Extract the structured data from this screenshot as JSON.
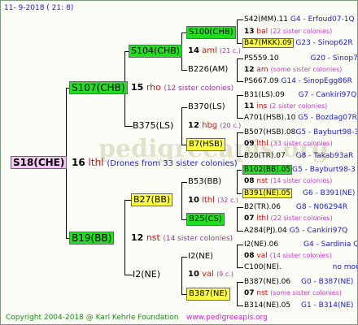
{
  "header": {
    "date": "11- 9-2018 ( 21: 8)"
  },
  "root": {
    "label": "S18(CHE)"
  },
  "root_info": {
    "num": "16",
    "code": "lthl",
    "note": "(Drones from 33 sister colonies)"
  },
  "gen1": [
    {
      "label": "S107(CHB)",
      "num": "15",
      "code": "rho",
      "note": "(12 sister colonies)"
    },
    {
      "label": "B19(BB)",
      "num": "12",
      "code": "nst",
      "note": "(14 sister colonies)"
    }
  ],
  "gen2": [
    {
      "label": "S104(CHB)",
      "num": "14",
      "code": "aml",
      "note": "(21 c.)"
    },
    {
      "label": "B375(LS)",
      "num": "12",
      "code": "hbg",
      "note": "(20 c.)"
    },
    {
      "label": "B27(BB)",
      "num": "10",
      "code": "lthl",
      "note": "(32 c.)"
    },
    {
      "label": "I2(NE)",
      "num": "10",
      "code": "val",
      "note": "(9 c.)"
    }
  ],
  "gen3": [
    {
      "label": "S100(CHB)"
    },
    {
      "label": "B226(AM)"
    },
    {
      "label": "B370(LS)"
    },
    {
      "label": "B7(HSB)"
    },
    {
      "label": "B53(BB)"
    },
    {
      "label": "B25(CS)"
    },
    {
      "label": "I2(NE)"
    },
    {
      "label": "B387(NE)"
    }
  ],
  "gen4": [
    {
      "a": "S42(MM).11",
      "a_note": "G4 - Erfoud07-1Q",
      "m_num": "13",
      "m_code": "bal",
      "m_note": "(22 sister colonies)",
      "b": "B47(MKK).09",
      "b_note": "G23 - Sinop62R"
    },
    {
      "a": "PS559.10",
      "a_note": "G20 - Sinop72R",
      "m_num": "12",
      "m_code": "am",
      "m_note": "(some sister colonies)",
      "b": "PS667.09",
      "b_note": "G14 - SinopEgg86R"
    },
    {
      "a": "B31(LS).09",
      "a_note": "G7 - Cankiri97Q",
      "m_num": "11",
      "m_code": "ins",
      "m_note": "(2 sister colonies)",
      "b": "A701(HSB).10",
      "b_note": "G5 - Bozdag07R"
    },
    {
      "a": "B507(HSB).08",
      "a_note": "G5 - Bayburt98-3",
      "m_num": "09",
      "m_code": "lthl",
      "m_note": "(33 sister colonies)",
      "b": "B20(TR).07",
      "b_note": "G8 - Takab93aR"
    },
    {
      "a": "B102(BB).05",
      "a_note": "G5 - Bayburt98-3",
      "m_num": "08",
      "m_code": "nst",
      "m_note": "(14 sister colonies)",
      "b": "B391(NE).05",
      "b_note": "G6 - B391(NE)"
    },
    {
      "a": "B2(TR).06",
      "a_note": "G8 - N06294R",
      "m_num": "07",
      "m_code": "lthl",
      "m_note": "(22 sister colonies)",
      "b": "A284(PJ).04",
      "b_note": "G5 - Cankiri97Q"
    },
    {
      "a": "I2(NE).06",
      "a_note": "G4 - Sardinia Q",
      "m_num": "08",
      "m_code": "val",
      "m_note": "(14 sister colonies)",
      "b": "C100(NE).",
      "b_note": "no more"
    },
    {
      "a": "B387(NE).06",
      "a_note": "G0 - B387(NE)",
      "m_num": "07",
      "m_code": "nst",
      "m_note": "(some sister colonies)",
      "b": "B314(NE).05",
      "b_note": "G1 - B314(NE)"
    }
  ],
  "footer": {
    "copyright": "Copyright 2004-2018 @ Karl Kehrle Foundation",
    "site": "www.pedigreeapis.org"
  },
  "watermark": "pedigreeapis.org",
  "colors": {
    "green": "#22dd22",
    "yellow": "#ffff44",
    "pink": "#f7c8f7",
    "blue": "#1a1acc",
    "red": "#cc1111",
    "purple": "#993399"
  }
}
